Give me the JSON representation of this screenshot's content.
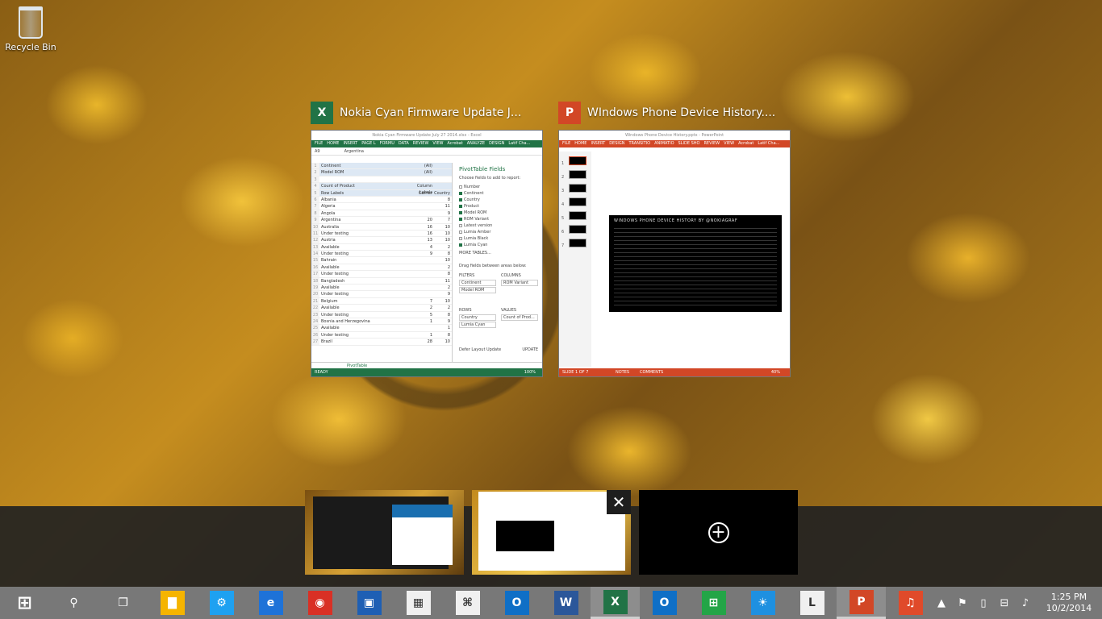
{
  "desktop": {
    "recycle_bin_label": "Recycle Bin"
  },
  "windows": [
    {
      "title": "Nokia Cyan Firmware Update J...",
      "app": "Excel",
      "app_icon_letter": "X",
      "accent": "#217346",
      "window_title": "Nokia Cyan Firmware Update July 27 2014.xlsx - Excel",
      "context_tab": "PIVOTTABLE T...",
      "tabs": [
        "FILE",
        "HOME",
        "INSERT",
        "PAGE L",
        "FORMU",
        "DATA",
        "REVIEW",
        "VIEW",
        "Acrobat",
        "ANALYZE",
        "DESIGN",
        "Latif Cha..."
      ],
      "name_box": "A9",
      "formula": "Argentina",
      "rows": [
        {
          "n": "1",
          "a": "Continent",
          "b": "(All)",
          "c": ""
        },
        {
          "n": "2",
          "a": "Model ROM",
          "b": "(All)",
          "c": ""
        },
        {
          "n": "3",
          "a": "",
          "b": "",
          "c": ""
        },
        {
          "n": "4",
          "a": "Count of Product",
          "b": "Column Labels",
          "c": ""
        },
        {
          "n": "5",
          "a": "Row Labels",
          "b": "Carrier",
          "c": "Country"
        },
        {
          "n": "6",
          "a": "Albania",
          "b": "",
          "c": "8"
        },
        {
          "n": "7",
          "a": "Algeria",
          "b": "",
          "c": "11"
        },
        {
          "n": "8",
          "a": "Angola",
          "b": "",
          "c": "9"
        },
        {
          "n": "9",
          "a": "Argentina",
          "b": "20",
          "c": "7"
        },
        {
          "n": "10",
          "a": "Australia",
          "b": "16",
          "c": "10"
        },
        {
          "n": "11",
          "a": "Under testing",
          "b": "16",
          "c": "10"
        },
        {
          "n": "12",
          "a": "Austria",
          "b": "13",
          "c": "10"
        },
        {
          "n": "13",
          "a": "Available",
          "b": "4",
          "c": "2"
        },
        {
          "n": "14",
          "a": "Under testing",
          "b": "9",
          "c": "8"
        },
        {
          "n": "15",
          "a": "Bahrain",
          "b": "",
          "c": "10"
        },
        {
          "n": "16",
          "a": "Available",
          "b": "",
          "c": "2"
        },
        {
          "n": "17",
          "a": "Under testing",
          "b": "",
          "c": "8"
        },
        {
          "n": "18",
          "a": "Bangladesh",
          "b": "",
          "c": "11"
        },
        {
          "n": "19",
          "a": "Available",
          "b": "",
          "c": "2"
        },
        {
          "n": "20",
          "a": "Under testing",
          "b": "",
          "c": "9"
        },
        {
          "n": "21",
          "a": "Belgium",
          "b": "7",
          "c": "10"
        },
        {
          "n": "22",
          "a": "Available",
          "b": "2",
          "c": "2"
        },
        {
          "n": "23",
          "a": "Under testing",
          "b": "5",
          "c": "8"
        },
        {
          "n": "24",
          "a": "Bosnia and Herzegovina",
          "b": "1",
          "c": "9"
        },
        {
          "n": "25",
          "a": "Available",
          "b": "",
          "c": "1"
        },
        {
          "n": "26",
          "a": "Under testing",
          "b": "1",
          "c": "8"
        },
        {
          "n": "27",
          "a": "Brazil",
          "b": "28",
          "c": "10"
        }
      ],
      "fields_title": "PivotTable Fields",
      "fields_sub": "Choose fields to add to report:",
      "fields": [
        {
          "name": "Number",
          "checked": false
        },
        {
          "name": "Continent",
          "checked": true
        },
        {
          "name": "Country",
          "checked": true
        },
        {
          "name": "Product",
          "checked": true
        },
        {
          "name": "Model ROM",
          "checked": true
        },
        {
          "name": "ROM Variant",
          "checked": true
        },
        {
          "name": "Latest version",
          "checked": false
        },
        {
          "name": "Lumia Amber",
          "checked": false
        },
        {
          "name": "Lumia Black",
          "checked": false
        },
        {
          "name": "Lumia Cyan",
          "checked": true
        }
      ],
      "more_tables": "MORE TABLES...",
      "drag_text": "Drag fields between areas below:",
      "areas": {
        "filters": "FILTERS",
        "columns": "COLUMNS",
        "rows": "ROWS",
        "values": "VALUES",
        "filter_items": [
          "Continent",
          "Model ROM"
        ],
        "column_items": [
          "ROM Variant"
        ],
        "row_items": [
          "Country",
          "Lumia Cyan"
        ],
        "value_items": [
          "Count of Prod..."
        ]
      },
      "defer": "Defer Layout Update",
      "update": "UPDATE",
      "sheet_tab": "PivotTable",
      "status": "READY",
      "zoom": "100%"
    },
    {
      "title": "WIndows Phone Device History....",
      "app": "PowerPoint",
      "app_icon_letter": "P",
      "accent": "#d24726",
      "window_title": "Windows Phone Device History.pptx - PowerPoint",
      "tabs": [
        "FILE",
        "HOME",
        "INSERT",
        "DESIGN",
        "TRANSITIO",
        "ANIMATIO",
        "SLIDE SHO",
        "REVIEW",
        "VIEW",
        "Acrobat",
        "Latif Cha..."
      ],
      "slide_numbers": [
        "1",
        "2",
        "3",
        "4",
        "5",
        "6",
        "7"
      ],
      "slide_title": "WINDOWS PHONE DEVICE HISTORY BY @NOKIAGRAF",
      "status": "SLIDE 1 OF 7",
      "notes": "NOTES",
      "comments": "COMMENTS",
      "zoom": "40%"
    }
  ],
  "task_view": {
    "close_label": "✕",
    "new_desktop": "+"
  },
  "taskbar": {
    "apps": [
      {
        "name": "start",
        "glyph": "⊞",
        "color": ""
      },
      {
        "name": "search",
        "glyph": "⚲",
        "color": ""
      },
      {
        "name": "task-view",
        "glyph": "❐",
        "color": ""
      },
      {
        "name": "file-explorer",
        "glyph": "▇",
        "color": "#f5b400"
      },
      {
        "name": "settings",
        "glyph": "⚙",
        "color": "#1ea1f1"
      },
      {
        "name": "internet-explorer",
        "glyph": "e",
        "color": "#1e72d8"
      },
      {
        "name": "chrome",
        "glyph": "◉",
        "color": "#d93025"
      },
      {
        "name": "photo-viewer",
        "glyph": "▣",
        "color": "#1e5fb4"
      },
      {
        "name": "calculator",
        "glyph": "▦",
        "color": "#f0f0f0"
      },
      {
        "name": "acrobat",
        "glyph": "⌘",
        "color": "#f0f0f0"
      },
      {
        "name": "outlook",
        "glyph": "O",
        "color": "#0f6fc6"
      },
      {
        "name": "word",
        "glyph": "W",
        "color": "#2b579a"
      },
      {
        "name": "excel",
        "glyph": "X",
        "color": "#217346",
        "active": true
      },
      {
        "name": "outlook-2",
        "glyph": "O",
        "color": "#0f6fc6"
      },
      {
        "name": "store",
        "glyph": "⊞",
        "color": "#23a547"
      },
      {
        "name": "weather",
        "glyph": "☀",
        "color": "#1e90e0"
      },
      {
        "name": "lync",
        "glyph": "L",
        "color": "#f0f0f0"
      },
      {
        "name": "powerpoint",
        "glyph": "P",
        "color": "#d24726",
        "active": true
      },
      {
        "name": "music",
        "glyph": "♫",
        "color": "#e04a2a"
      }
    ],
    "tray": [
      "▲",
      "⚑",
      "▯",
      "⊟",
      "♪"
    ],
    "time": "1:25 PM",
    "date": "10/2/2014"
  }
}
